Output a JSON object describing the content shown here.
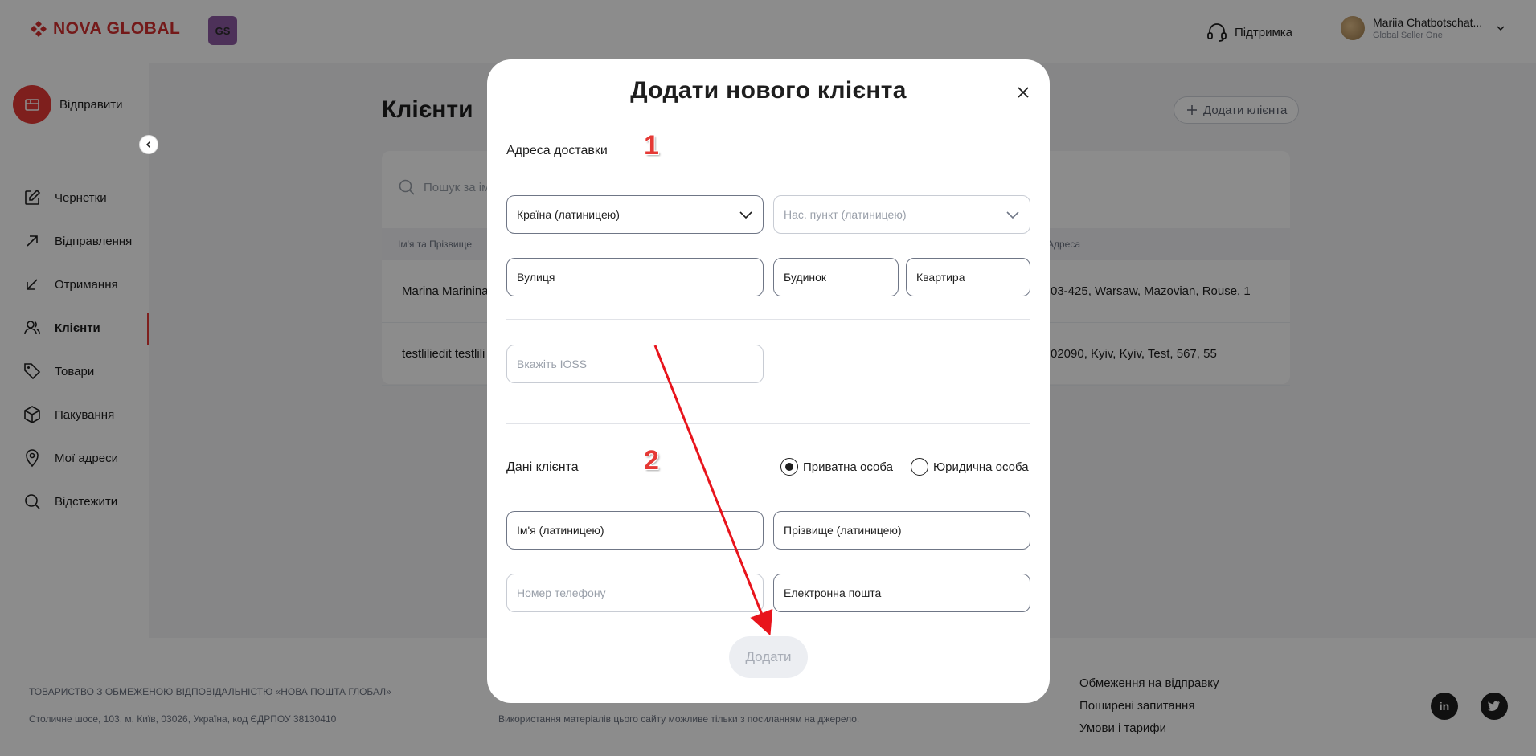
{
  "header": {
    "logo_text": "NOVA GLOBAL",
    "badge": "GS",
    "support_label": "Підтримка",
    "user_name": "Mariia Chatbotschat...",
    "user_subtitle": "Global Seller One"
  },
  "sidebar": {
    "send_label": "Відправити",
    "items": [
      {
        "label": "Чернетки",
        "icon": "edit-icon"
      },
      {
        "label": "Відправлення",
        "icon": "arrow-up-right-icon"
      },
      {
        "label": "Отримання",
        "icon": "arrow-down-left-icon"
      },
      {
        "label": "Клієнти",
        "icon": "users-icon",
        "active": true
      },
      {
        "label": "Товари",
        "icon": "tag-icon"
      },
      {
        "label": "Пакування",
        "icon": "box-icon"
      },
      {
        "label": "Мої адреси",
        "icon": "location-pin-icon"
      },
      {
        "label": "Відстежити",
        "icon": "search-icon"
      }
    ]
  },
  "main": {
    "title": "Клієнти",
    "add_button": "Додати клієнта",
    "search_placeholder": "Пошук за ім",
    "columns": [
      "Ім'я та Прізвище",
      "Адреса"
    ],
    "rows": [
      {
        "name": "Marina Marinina",
        "address": "03-425, Warsaw, Mazovian, Rouse, 1"
      },
      {
        "name": "testliliedit testlili",
        "address": "02090, Kyiv, Kyiv, Test, 567, 55"
      }
    ]
  },
  "footer": {
    "company": "ТОВАРИСТВО З ОБМЕЖЕНОЮ ВІДПОВІДАЛЬНІСТЮ «НОВА ПОШТА ГЛОБАЛ»",
    "address": "Столичне шосе, 103, м. Київ, 03026, Україна, код ЄДРПОУ 38130410",
    "copyright": "Використання матеріалів цього сайту можливе тільки з посиланням на джерело.",
    "links": [
      "Обмеження на відправку",
      "Поширені запитання",
      "Умови і тарифи"
    ],
    "social": [
      "in",
      "twitter"
    ]
  },
  "modal": {
    "title": "Додати нового клієнта",
    "address_section": "Адреса доставки",
    "client_section": "Дані клієнта",
    "step1": "1",
    "step2": "2",
    "country": "Країна (латиницею)",
    "city": "Нас. пункт (латиницею)",
    "street": "Вулиця",
    "house": "Будинок",
    "apartment": "Квартира",
    "ioss": "Вкажіть IOSS",
    "radio_private": "Приватна особа",
    "radio_legal": "Юридична особа",
    "first_name": "Ім'я (латиницею)",
    "last_name": "Прізвище (латиницею)",
    "phone": "Номер телефону",
    "email": "Електронна пошта",
    "submit": "Додати"
  },
  "colors": {
    "accent": "#e53935",
    "overlay": "rgba(0,0,0,0.45)"
  }
}
